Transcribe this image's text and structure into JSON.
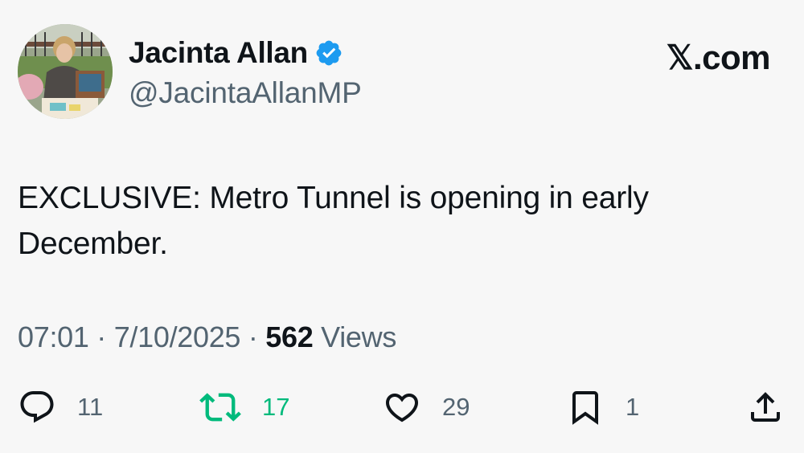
{
  "author": {
    "display_name": "Jacinta Allan",
    "handle": "@JacintaAllanMP",
    "verified": true
  },
  "site_label": "𝕏.com",
  "tweet": {
    "text_line1": "EXCLUSIVE: Metro Tunnel is opening in early",
    "text_line2": "December."
  },
  "meta": {
    "time": "07:01",
    "separator": "·",
    "date": "7/10/2025",
    "views_count": "562",
    "views_label": "Views"
  },
  "actions": {
    "reply": {
      "icon": "reply-icon",
      "count": "11"
    },
    "retweet": {
      "icon": "retweet-icon",
      "count": "17",
      "color": "#00ba7c"
    },
    "like": {
      "icon": "heart-icon",
      "count": "29"
    },
    "bookmark": {
      "icon": "bookmark-icon",
      "count": "1"
    },
    "share": {
      "icon": "share-icon"
    }
  },
  "colors": {
    "background": "#f7f7f7",
    "text": "#0f1419",
    "secondary": "#536471",
    "verified": "#1d9bf0",
    "retweet_active": "#00ba7c"
  }
}
